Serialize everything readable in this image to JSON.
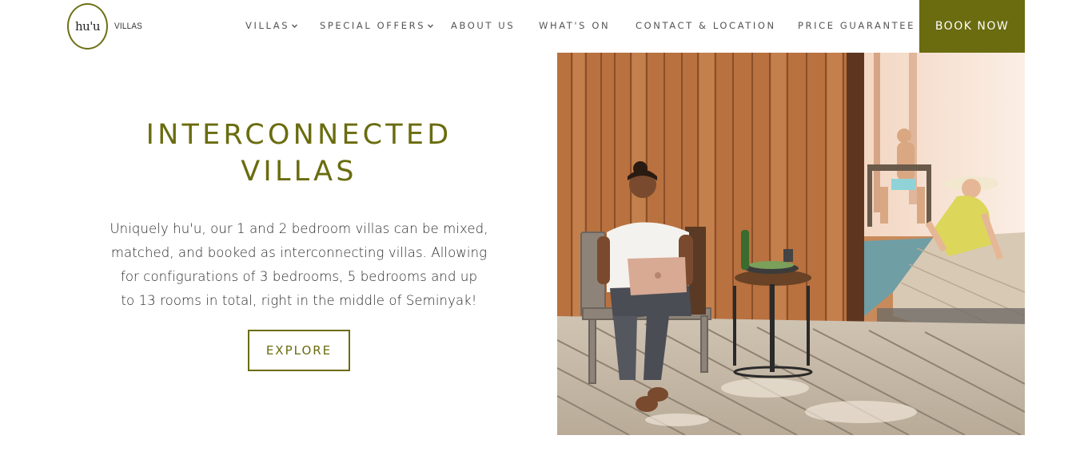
{
  "logo": {
    "mark": "hu'u",
    "word": "VILLAS"
  },
  "nav": {
    "villas": "VILLAS",
    "special_offers": "SPECIAL OFFERS",
    "about_us": "ABOUT US",
    "whats_on": "WHAT'S ON",
    "contact": "CONTACT & LOCATION",
    "price_guarantee": "PRICE GUARANTEE",
    "book_now": "BOOK NOW"
  },
  "hero": {
    "heading_line1": "INTERCONNECTED",
    "heading_line2": "VILLAS",
    "desc_line1": "Uniquely hu'u, our 1 and 2 bedroom villas can be mixed,",
    "desc_line2": "matched, and booked as interconnecting villas. Allowing",
    "desc_line3": "for configurations of 3 bedrooms, 5 bedrooms and up",
    "desc_line4": "to 13 rooms in total, right in the middle of Seminyak!",
    "explore_label": "EXPLORE"
  },
  "colors": {
    "accent": "#6a6c0f",
    "text": "#2b2b2b",
    "nav_text": "#555555"
  },
  "icons": {
    "dropdown": "chevron-down-icon"
  }
}
